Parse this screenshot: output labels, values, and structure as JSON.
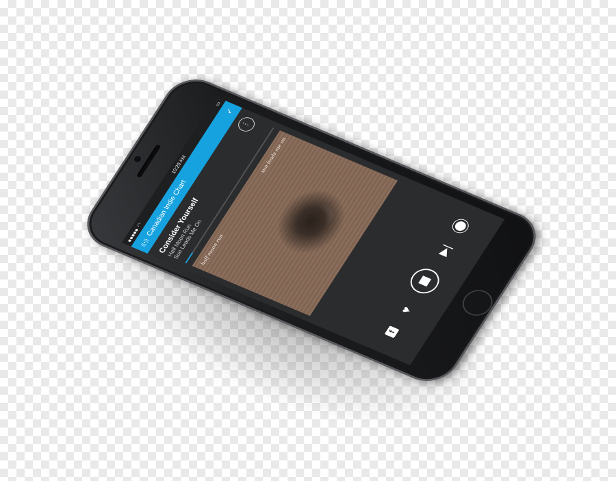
{
  "status_bar": {
    "time": "10:29 AM"
  },
  "station": {
    "name": "Canadian Indie Chart"
  },
  "now_playing": {
    "song": "Consider Yourself",
    "artist": "Half Moon Run",
    "album": "Sun Leads Me On",
    "progress": 0.08
  },
  "album_art": {
    "left_text": "half moon run",
    "right_text": "sun leads me on"
  },
  "colors": {
    "accent": "#16a2df",
    "screen_bg": "#2b2c2e"
  },
  "icons": [
    "radio-icon",
    "check-icon",
    "more-icon",
    "facebook-icon",
    "heart-icon",
    "stop-icon",
    "skip-icon",
    "settings-icon"
  ]
}
